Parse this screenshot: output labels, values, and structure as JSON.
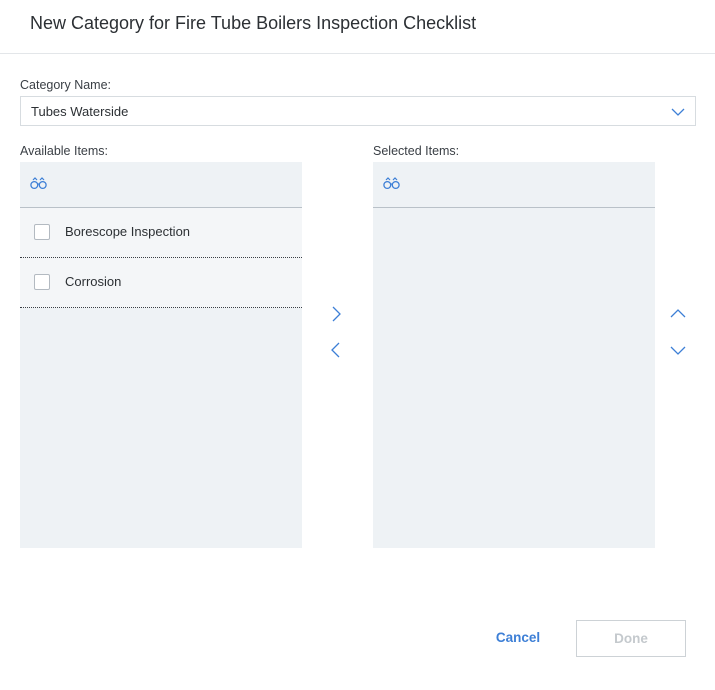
{
  "dialog": {
    "title": "New Category for Fire Tube Boilers Inspection Checklist"
  },
  "category": {
    "label": "Category Name:",
    "value": "Tubes Waterside",
    "icon": "chevron-down-icon"
  },
  "available": {
    "label": "Available Items:",
    "search_icon": "binoculars-icon",
    "items": [
      {
        "label": "Borescope Inspection",
        "checked": false
      },
      {
        "label": "Corrosion",
        "checked": false
      }
    ]
  },
  "selected": {
    "label": "Selected Items:",
    "search_icon": "binoculars-icon",
    "items": []
  },
  "transfer": {
    "add_icon": "chevron-right-icon",
    "remove_icon": "chevron-left-icon"
  },
  "order": {
    "up_icon": "chevron-up-icon",
    "down_icon": "chevron-down-icon"
  },
  "footer": {
    "cancel_label": "Cancel",
    "done_label": "Done"
  },
  "colors": {
    "accent": "#3d7fd6",
    "panel_bg": "#eef2f5",
    "item_bg": "#f4f6f8",
    "disabled_text": "#c4c9cd"
  }
}
